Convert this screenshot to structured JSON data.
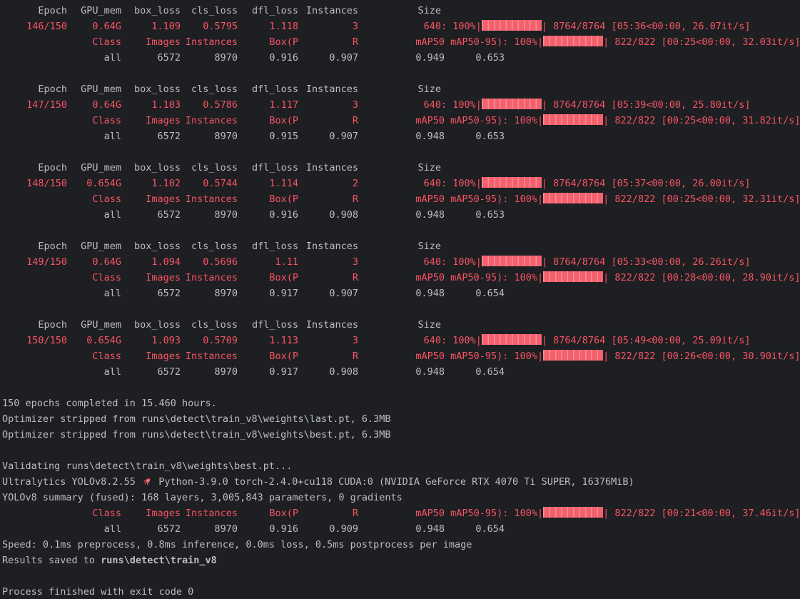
{
  "colors": {
    "background": "#1e1f22",
    "foreground": "#bcbec4",
    "red_accent": "#f75464",
    "bar_fill": "#f4606c",
    "bar_separator": "#f88e97"
  },
  "terminal": {
    "lines": [
      [
        {
          "t": "Epoch",
          "k": "c1",
          "c": "fg"
        },
        {
          "t": "GPU_mem",
          "k": "c2",
          "c": "fg"
        },
        {
          "t": "box_loss",
          "k": "c3",
          "c": "fg"
        },
        {
          "t": "cls_loss",
          "k": "c4",
          "c": "fg"
        },
        {
          "t": "dfl_loss",
          "k": "c5",
          "c": "fg"
        },
        {
          "t": "Instances",
          "k": "c6",
          "c": "fg"
        },
        {
          "t": "Size",
          "k": "c7",
          "c": "fg"
        }
      ],
      [
        {
          "t": "146/150",
          "k": "c1",
          "c": "red"
        },
        {
          "t": "0.64G",
          "k": "c2",
          "c": "red"
        },
        {
          "t": "1.109",
          "k": "c3",
          "c": "red"
        },
        {
          "t": "0.5795",
          "k": "c4",
          "c": "red"
        },
        {
          "t": "1.118",
          "k": "c5",
          "c": "red"
        },
        {
          "t": "3",
          "k": "c6",
          "c": "red"
        },
        {
          "t": "640",
          "k": "c7",
          "c": "red"
        },
        {
          "t": ": 100%|",
          "c": "red"
        },
        {
          "bar": true
        },
        {
          "t": "| 8764/8764 [05:36<00:00, 26.07it/s]",
          "c": "red"
        }
      ],
      [
        {
          "t": "Class",
          "k": "v1",
          "c": "red"
        },
        {
          "t": "Images",
          "k": "v2",
          "c": "red"
        },
        {
          "t": "Instances",
          "k": "v3",
          "c": "red"
        },
        {
          "t": "Box(P",
          "k": "v4",
          "c": "red"
        },
        {
          "t": "R",
          "k": "v5",
          "c": "red"
        },
        {
          "t": "mAP50",
          "k": "v6",
          "c": "red"
        },
        {
          "t": " mAP50-95): 100%|",
          "c": "red"
        },
        {
          "bar": true
        },
        {
          "t": "| 822/822 [00:25<00:00, 32.03it/s]",
          "c": "red"
        }
      ],
      [
        {
          "t": "all",
          "k": "v1",
          "c": "fg"
        },
        {
          "t": "6572",
          "k": "v2",
          "c": "fg"
        },
        {
          "t": "8970",
          "k": "v3",
          "c": "fg"
        },
        {
          "t": "0.916",
          "k": "v4",
          "c": "fg"
        },
        {
          "t": "0.907",
          "k": "v5",
          "c": "fg"
        },
        {
          "t": "0.949",
          "k": "v6",
          "c": "fg"
        },
        {
          "t": "0.653",
          "k": "v7",
          "c": "fg"
        }
      ],
      [],
      [
        {
          "t": "Epoch",
          "k": "c1",
          "c": "fg"
        },
        {
          "t": "GPU_mem",
          "k": "c2",
          "c": "fg"
        },
        {
          "t": "box_loss",
          "k": "c3",
          "c": "fg"
        },
        {
          "t": "cls_loss",
          "k": "c4",
          "c": "fg"
        },
        {
          "t": "dfl_loss",
          "k": "c5",
          "c": "fg"
        },
        {
          "t": "Instances",
          "k": "c6",
          "c": "fg"
        },
        {
          "t": "Size",
          "k": "c7",
          "c": "fg"
        }
      ],
      [
        {
          "t": "147/150",
          "k": "c1",
          "c": "red"
        },
        {
          "t": "0.64G",
          "k": "c2",
          "c": "red"
        },
        {
          "t": "1.103",
          "k": "c3",
          "c": "red"
        },
        {
          "t": "0.5786",
          "k": "c4",
          "c": "red"
        },
        {
          "t": "1.117",
          "k": "c5",
          "c": "red"
        },
        {
          "t": "3",
          "k": "c6",
          "c": "red"
        },
        {
          "t": "640",
          "k": "c7",
          "c": "red"
        },
        {
          "t": ": 100%|",
          "c": "red"
        },
        {
          "bar": true
        },
        {
          "t": "| 8764/8764 [05:39<00:00, 25.80it/s]",
          "c": "red"
        }
      ],
      [
        {
          "t": "Class",
          "k": "v1",
          "c": "red"
        },
        {
          "t": "Images",
          "k": "v2",
          "c": "red"
        },
        {
          "t": "Instances",
          "k": "v3",
          "c": "red"
        },
        {
          "t": "Box(P",
          "k": "v4",
          "c": "red"
        },
        {
          "t": "R",
          "k": "v5",
          "c": "red"
        },
        {
          "t": "mAP50",
          "k": "v6",
          "c": "red"
        },
        {
          "t": " mAP50-95): 100%|",
          "c": "red"
        },
        {
          "bar": true
        },
        {
          "t": "| 822/822 [00:25<00:00, 31.82it/s]",
          "c": "red"
        }
      ],
      [
        {
          "t": "all",
          "k": "v1",
          "c": "fg"
        },
        {
          "t": "6572",
          "k": "v2",
          "c": "fg"
        },
        {
          "t": "8970",
          "k": "v3",
          "c": "fg"
        },
        {
          "t": "0.915",
          "k": "v4",
          "c": "fg"
        },
        {
          "t": "0.907",
          "k": "v5",
          "c": "fg"
        },
        {
          "t": "0.948",
          "k": "v6",
          "c": "fg"
        },
        {
          "t": "0.653",
          "k": "v7",
          "c": "fg"
        }
      ],
      [],
      [
        {
          "t": "Epoch",
          "k": "c1",
          "c": "fg"
        },
        {
          "t": "GPU_mem",
          "k": "c2",
          "c": "fg"
        },
        {
          "t": "box_loss",
          "k": "c3",
          "c": "fg"
        },
        {
          "t": "cls_loss",
          "k": "c4",
          "c": "fg"
        },
        {
          "t": "dfl_loss",
          "k": "c5",
          "c": "fg"
        },
        {
          "t": "Instances",
          "k": "c6",
          "c": "fg"
        },
        {
          "t": "Size",
          "k": "c7",
          "c": "fg"
        }
      ],
      [
        {
          "t": "148/150",
          "k": "c1",
          "c": "red"
        },
        {
          "t": "0.654G",
          "k": "c2",
          "c": "red"
        },
        {
          "t": "1.102",
          "k": "c3",
          "c": "red"
        },
        {
          "t": "0.5744",
          "k": "c4",
          "c": "red"
        },
        {
          "t": "1.114",
          "k": "c5",
          "c": "red"
        },
        {
          "t": "2",
          "k": "c6",
          "c": "red"
        },
        {
          "t": "640",
          "k": "c7",
          "c": "red"
        },
        {
          "t": ": 100%|",
          "c": "red"
        },
        {
          "bar": true
        },
        {
          "t": "| 8764/8764 [05:37<00:00, 26.00it/s]",
          "c": "red"
        }
      ],
      [
        {
          "t": "Class",
          "k": "v1",
          "c": "red"
        },
        {
          "t": "Images",
          "k": "v2",
          "c": "red"
        },
        {
          "t": "Instances",
          "k": "v3",
          "c": "red"
        },
        {
          "t": "Box(P",
          "k": "v4",
          "c": "red"
        },
        {
          "t": "R",
          "k": "v5",
          "c": "red"
        },
        {
          "t": "mAP50",
          "k": "v6",
          "c": "red"
        },
        {
          "t": " mAP50-95): 100%|",
          "c": "red"
        },
        {
          "bar": true
        },
        {
          "t": "| 822/822 [00:25<00:00, 32.31it/s]",
          "c": "red"
        }
      ],
      [
        {
          "t": "all",
          "k": "v1",
          "c": "fg"
        },
        {
          "t": "6572",
          "k": "v2",
          "c": "fg"
        },
        {
          "t": "8970",
          "k": "v3",
          "c": "fg"
        },
        {
          "t": "0.916",
          "k": "v4",
          "c": "fg"
        },
        {
          "t": "0.908",
          "k": "v5",
          "c": "fg"
        },
        {
          "t": "0.948",
          "k": "v6",
          "c": "fg"
        },
        {
          "t": "0.653",
          "k": "v7",
          "c": "fg"
        }
      ],
      [],
      [
        {
          "t": "Epoch",
          "k": "c1",
          "c": "fg"
        },
        {
          "t": "GPU_mem",
          "k": "c2",
          "c": "fg"
        },
        {
          "t": "box_loss",
          "k": "c3",
          "c": "fg"
        },
        {
          "t": "cls_loss",
          "k": "c4",
          "c": "fg"
        },
        {
          "t": "dfl_loss",
          "k": "c5",
          "c": "fg"
        },
        {
          "t": "Instances",
          "k": "c6",
          "c": "fg"
        },
        {
          "t": "Size",
          "k": "c7",
          "c": "fg"
        }
      ],
      [
        {
          "t": "149/150",
          "k": "c1",
          "c": "red"
        },
        {
          "t": "0.64G",
          "k": "c2",
          "c": "red"
        },
        {
          "t": "1.094",
          "k": "c3",
          "c": "red"
        },
        {
          "t": "0.5696",
          "k": "c4",
          "c": "red"
        },
        {
          "t": "1.11",
          "k": "c5",
          "c": "red"
        },
        {
          "t": "3",
          "k": "c6",
          "c": "red"
        },
        {
          "t": "640",
          "k": "c7",
          "c": "red"
        },
        {
          "t": ": 100%|",
          "c": "red"
        },
        {
          "bar": true
        },
        {
          "t": "| 8764/8764 [05:33<00:00, 26.26it/s]",
          "c": "red"
        }
      ],
      [
        {
          "t": "Class",
          "k": "v1",
          "c": "red"
        },
        {
          "t": "Images",
          "k": "v2",
          "c": "red"
        },
        {
          "t": "Instances",
          "k": "v3",
          "c": "red"
        },
        {
          "t": "Box(P",
          "k": "v4",
          "c": "red"
        },
        {
          "t": "R",
          "k": "v5",
          "c": "red"
        },
        {
          "t": "mAP50",
          "k": "v6",
          "c": "red"
        },
        {
          "t": " mAP50-95): 100%|",
          "c": "red"
        },
        {
          "bar": true
        },
        {
          "t": "| 822/822 [00:28<00:00, 28.90it/s]",
          "c": "red"
        }
      ],
      [
        {
          "t": "all",
          "k": "v1",
          "c": "fg"
        },
        {
          "t": "6572",
          "k": "v2",
          "c": "fg"
        },
        {
          "t": "8970",
          "k": "v3",
          "c": "fg"
        },
        {
          "t": "0.917",
          "k": "v4",
          "c": "fg"
        },
        {
          "t": "0.907",
          "k": "v5",
          "c": "fg"
        },
        {
          "t": "0.948",
          "k": "v6",
          "c": "fg"
        },
        {
          "t": "0.654",
          "k": "v7",
          "c": "fg"
        }
      ],
      [],
      [
        {
          "t": "Epoch",
          "k": "c1",
          "c": "fg"
        },
        {
          "t": "GPU_mem",
          "k": "c2",
          "c": "fg"
        },
        {
          "t": "box_loss",
          "k": "c3",
          "c": "fg"
        },
        {
          "t": "cls_loss",
          "k": "c4",
          "c": "fg"
        },
        {
          "t": "dfl_loss",
          "k": "c5",
          "c": "fg"
        },
        {
          "t": "Instances",
          "k": "c6",
          "c": "fg"
        },
        {
          "t": "Size",
          "k": "c7",
          "c": "fg"
        }
      ],
      [
        {
          "t": "150/150",
          "k": "c1",
          "c": "red"
        },
        {
          "t": "0.654G",
          "k": "c2",
          "c": "red"
        },
        {
          "t": "1.093",
          "k": "c3",
          "c": "red"
        },
        {
          "t": "0.5709",
          "k": "c4",
          "c": "red"
        },
        {
          "t": "1.113",
          "k": "c5",
          "c": "red"
        },
        {
          "t": "3",
          "k": "c6",
          "c": "red"
        },
        {
          "t": "640",
          "k": "c7",
          "c": "red"
        },
        {
          "t": ": 100%|",
          "c": "red"
        },
        {
          "bar": true
        },
        {
          "t": "| 8764/8764 [05:49<00:00, 25.09it/s]",
          "c": "red"
        }
      ],
      [
        {
          "t": "Class",
          "k": "v1",
          "c": "red"
        },
        {
          "t": "Images",
          "k": "v2",
          "c": "red"
        },
        {
          "t": "Instances",
          "k": "v3",
          "c": "red"
        },
        {
          "t": "Box(P",
          "k": "v4",
          "c": "red"
        },
        {
          "t": "R",
          "k": "v5",
          "c": "red"
        },
        {
          "t": "mAP50",
          "k": "v6",
          "c": "red"
        },
        {
          "t": " mAP50-95): 100%|",
          "c": "red"
        },
        {
          "bar": true
        },
        {
          "t": "| 822/822 [00:26<00:00, 30.90it/s]",
          "c": "red"
        }
      ],
      [
        {
          "t": "all",
          "k": "v1",
          "c": "fg"
        },
        {
          "t": "6572",
          "k": "v2",
          "c": "fg"
        },
        {
          "t": "8970",
          "k": "v3",
          "c": "fg"
        },
        {
          "t": "0.917",
          "k": "v4",
          "c": "fg"
        },
        {
          "t": "0.908",
          "k": "v5",
          "c": "fg"
        },
        {
          "t": "0.948",
          "k": "v6",
          "c": "fg"
        },
        {
          "t": "0.654",
          "k": "v7",
          "c": "fg"
        }
      ],
      [],
      [
        {
          "t": "150 epochs completed in 15.460 hours.",
          "c": "fg"
        }
      ],
      [
        {
          "t": "Optimizer stripped from runs\\detect\\train_v8\\weights\\last.pt, 6.3MB",
          "c": "fg"
        }
      ],
      [
        {
          "t": "Optimizer stripped from runs\\detect\\train_v8\\weights\\best.pt, 6.3MB",
          "c": "fg"
        }
      ],
      [],
      [
        {
          "t": "Validating runs\\detect\\train_v8\\weights\\best.pt...",
          "c": "fg"
        }
      ],
      [
        {
          "t": "Ultralytics YOLOv8.2.55 ",
          "c": "fg"
        },
        {
          "rocket": true
        },
        {
          "t": " Python-3.9.0 torch-2.4.0+cu118 CUDA:0 (NVIDIA GeForce RTX 4070 Ti SUPER, 16376MiB)",
          "c": "fg"
        }
      ],
      [
        {
          "t": "YOLOv8 summary (fused): 168 layers, 3,005,843 parameters, 0 gradients",
          "c": "fg"
        }
      ],
      [
        {
          "t": "Class",
          "k": "v1",
          "c": "red"
        },
        {
          "t": "Images",
          "k": "v2",
          "c": "red"
        },
        {
          "t": "Instances",
          "k": "v3",
          "c": "red"
        },
        {
          "t": "Box(P",
          "k": "v4",
          "c": "red"
        },
        {
          "t": "R",
          "k": "v5",
          "c": "red"
        },
        {
          "t": "mAP50",
          "k": "v6",
          "c": "red"
        },
        {
          "t": " mAP50-95): 100%|",
          "c": "red"
        },
        {
          "bar": true
        },
        {
          "t": "| 822/822 [00:21<00:00, 37.46it/s]",
          "c": "red"
        }
      ],
      [
        {
          "t": "all",
          "k": "v1",
          "c": "fg"
        },
        {
          "t": "6572",
          "k": "v2",
          "c": "fg"
        },
        {
          "t": "8970",
          "k": "v3",
          "c": "fg"
        },
        {
          "t": "0.916",
          "k": "v4",
          "c": "fg"
        },
        {
          "t": "0.909",
          "k": "v5",
          "c": "fg"
        },
        {
          "t": "0.948",
          "k": "v6",
          "c": "fg"
        },
        {
          "t": "0.654",
          "k": "v7",
          "c": "fg"
        }
      ],
      [
        {
          "t": "Speed: 0.1ms preprocess, 0.8ms inference, 0.0ms loss, 0.5ms postprocess per image",
          "c": "fg"
        }
      ],
      [
        {
          "t": "Results saved to ",
          "c": "fg"
        },
        {
          "t": "runs\\detect\\train_v8",
          "c": "fg",
          "b": true,
          "n": "results-path"
        }
      ],
      [],
      [
        {
          "t": "Process finished with exit code 0",
          "c": "fg",
          "n": "exit-status"
        }
      ]
    ]
  }
}
